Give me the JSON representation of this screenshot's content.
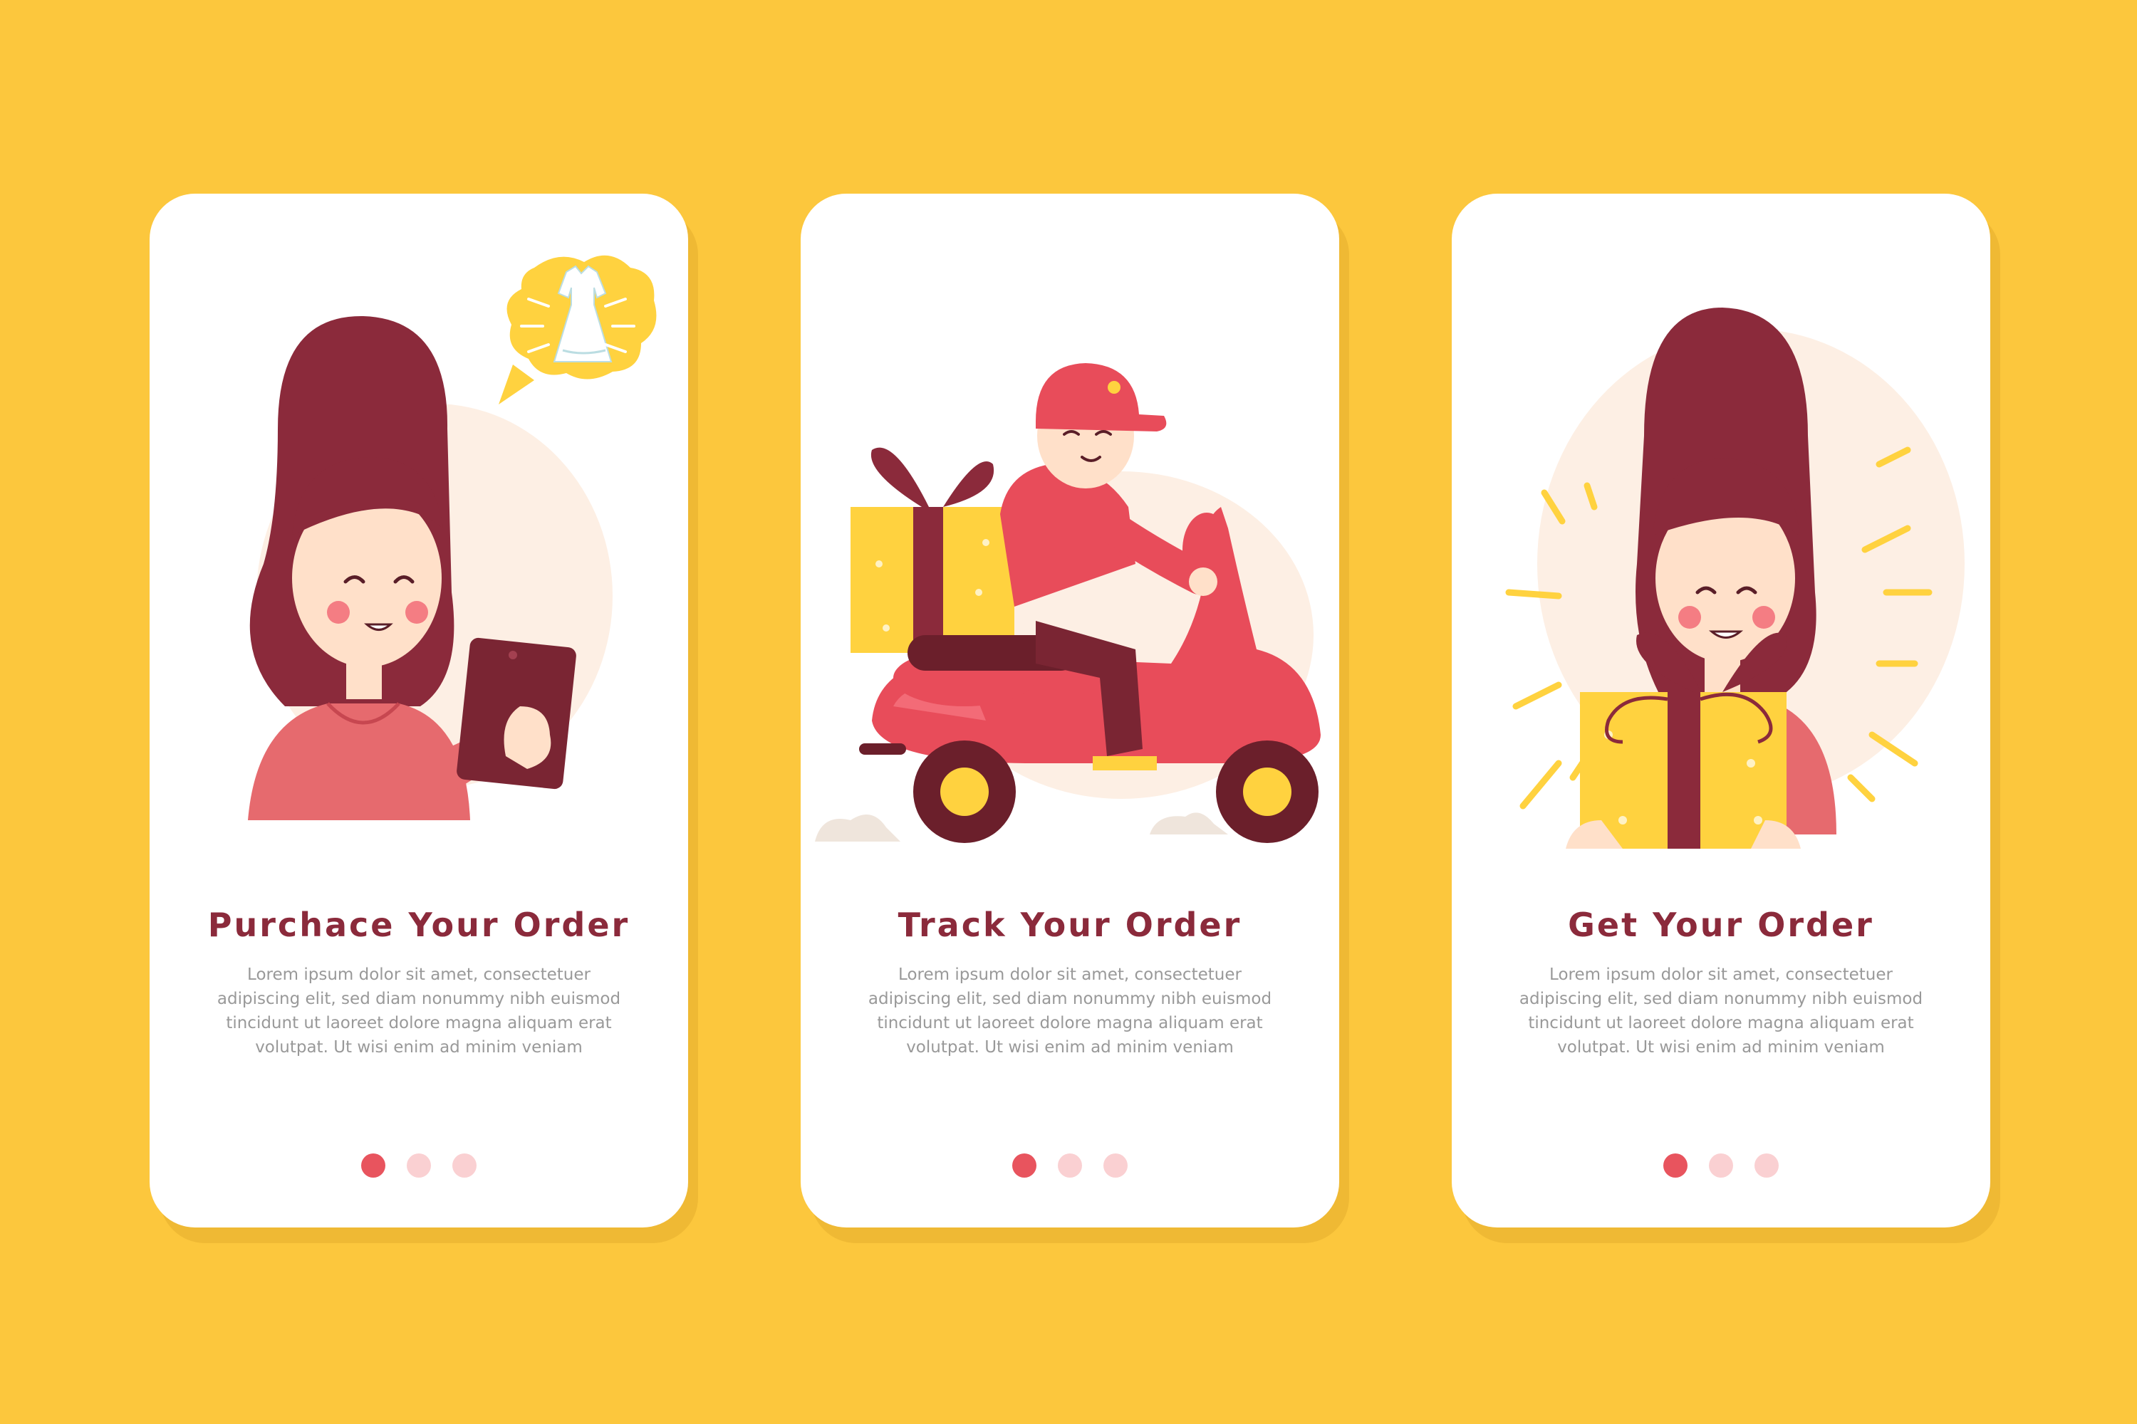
{
  "colors": {
    "background": "#FCC73D",
    "card": "#FFFFFF",
    "title": "#8B2A3B",
    "body_text": "#999999",
    "dot_active": "#E8545E",
    "dot_inactive": "#FAD0D2"
  },
  "screens": [
    {
      "title": "Purchace Your Order",
      "body": "Lorem ipsum dolor sit amet, consectetuer adipiscing elit, sed diam nonummy nibh euismod tincidunt ut laoreet dolore magna aliquam erat volutpat. Ut wisi enim ad minim veniam",
      "illustration": "woman-with-tablet-and-dress-icon",
      "pagination": {
        "total": 3,
        "active": 1
      }
    },
    {
      "title": "Track Your Order",
      "body": "Lorem ipsum dolor sit amet, consectetuer adipiscing elit, sed diam nonummy nibh euismod tincidunt ut laoreet dolore magna aliquam erat volutpat. Ut wisi enim ad minim veniam",
      "illustration": "courier-on-scooter-icon",
      "pagination": {
        "total": 3,
        "active": 1
      }
    },
    {
      "title": "Get Your Order",
      "body": "Lorem ipsum dolor sit amet, consectetuer adipiscing elit, sed diam nonummy nibh euismod tincidunt ut laoreet dolore magna aliquam erat volutpat. Ut wisi enim ad minim veniam",
      "illustration": "woman-with-gift-icon",
      "pagination": {
        "total": 3,
        "active": 1
      }
    }
  ]
}
